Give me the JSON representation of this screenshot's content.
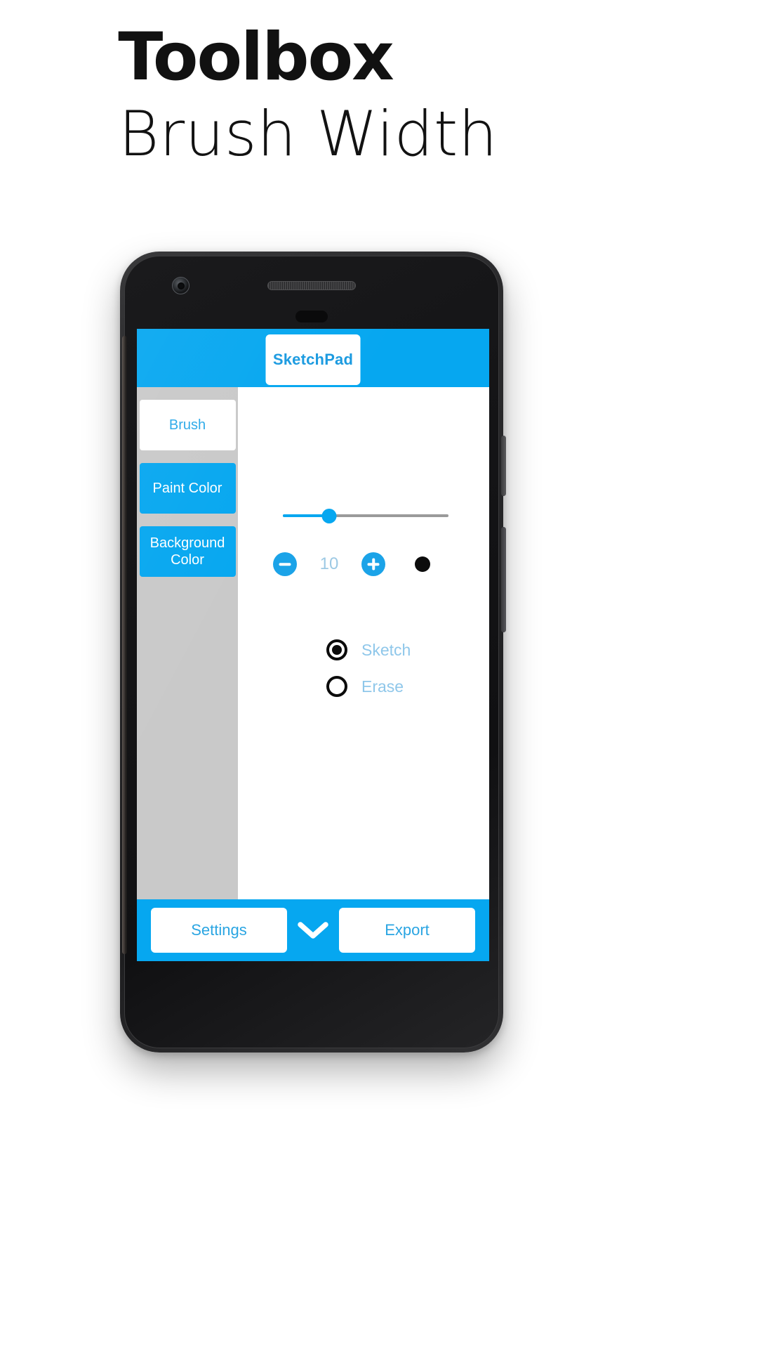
{
  "headline": {
    "title": "Toolbox",
    "subtitle": "Brush Width"
  },
  "colors": {
    "accent": "#06a7f0",
    "accent_light": "#8fc7ea",
    "sidebar_bg": "#c9c9c9",
    "track_inactive": "#9a9a9a",
    "dot_preview": "#0c0c0c"
  },
  "app": {
    "appbar": {
      "title": "SketchPad"
    },
    "sidebar": {
      "items": [
        {
          "label": "Brush",
          "selected": true
        },
        {
          "label": "Paint Color",
          "selected": false
        },
        {
          "label": "Background Color",
          "selected": false
        }
      ]
    },
    "brush_panel": {
      "slider": {
        "value": 10,
        "min": 1,
        "max": 30,
        "percent": 28
      },
      "stepper": {
        "decrement_icon": "minus-circle-icon",
        "value": "10",
        "increment_icon": "plus-circle-icon",
        "preview_icon": "brush-dot-preview"
      },
      "modes": [
        {
          "label": "Sketch",
          "selected": true
        },
        {
          "label": "Erase",
          "selected": false
        }
      ]
    },
    "bottombar": {
      "settings_label": "Settings",
      "expand_icon": "chevron-down-icon",
      "export_label": "Export"
    }
  },
  "device": {
    "camera_icon": "front-camera-icon",
    "speaker_icon": "earpiece-speaker-icon",
    "sensor_icon": "proximity-sensor-icon"
  }
}
